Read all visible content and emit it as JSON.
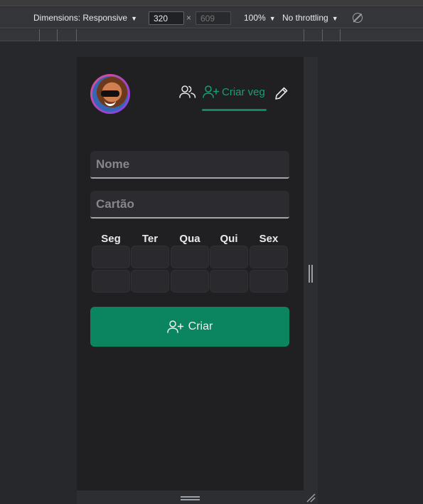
{
  "devtools": {
    "dimensions_label": "Dimensions: Responsive",
    "width_value": "320",
    "height_placeholder": "609",
    "times_symbol": "×",
    "zoom_label": "100%",
    "throttling_label": "No throttling",
    "caret": "▼"
  },
  "app": {
    "nav": {
      "group_icon": "users-icon",
      "create_tab_label": "Criar veg",
      "create_tab_icon": "user-plus-icon",
      "edit_icon": "pencil-icon"
    },
    "form": {
      "name_placeholder": "Nome",
      "name_value": "",
      "card_placeholder": "Cartão",
      "card_value": ""
    },
    "days": [
      "Seg",
      "Ter",
      "Qua",
      "Qui",
      "Sex"
    ],
    "create_button_label": "Criar",
    "accent_color": "#0b8460"
  }
}
